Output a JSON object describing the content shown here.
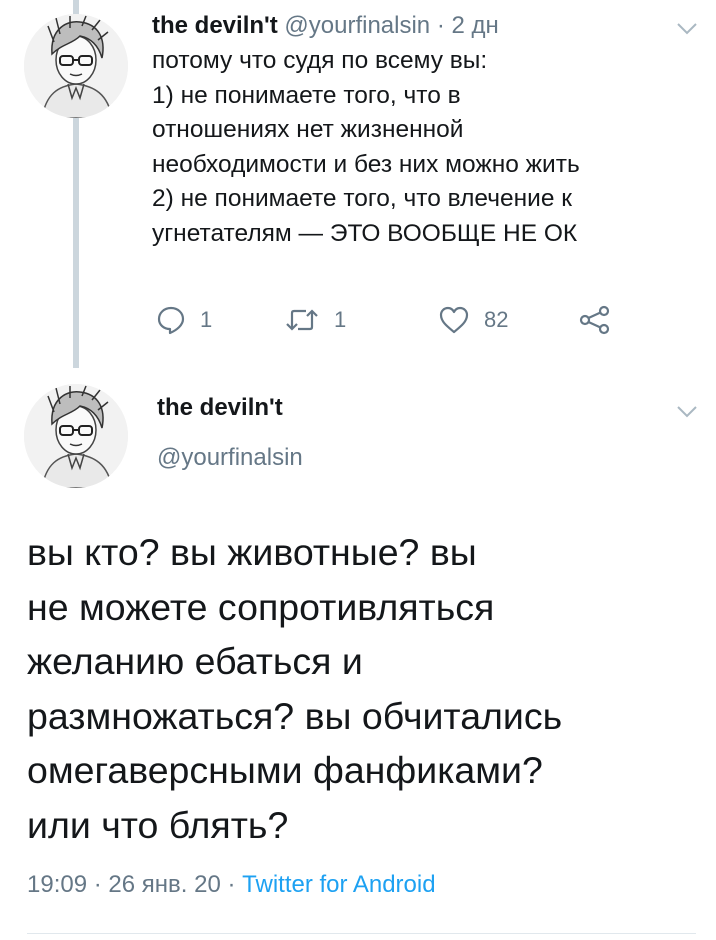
{
  "tweet1": {
    "author_name": "the deviln't",
    "handle": "@yourfinalsin",
    "separator": "·",
    "time": "2 дн",
    "lines": [
      "потому что судя по всему вы:",
      "1) не понимаете того, что в",
      "отношениях нет жизненной",
      "необходимости и без них можно жить",
      "2) не понимаете того, что влечение к",
      "угнетателям — ЭТО ВООБЩЕ НЕ ОК"
    ],
    "actions": {
      "reply_count": "1",
      "retweet_count": "1",
      "like_count": "82"
    }
  },
  "tweet2": {
    "author_name": "the deviln't",
    "handle": "@yourfinalsin",
    "lines": [
      "вы кто? вы животные? вы",
      "не можете сопротивляться",
      "желанию ебаться и",
      "размножаться? вы обчитались",
      "омегаверсными фанфиками?",
      "или что блять?"
    ],
    "meta": {
      "time": "19:09",
      "separator": "·",
      "date": "26 янв. 20",
      "source": "Twitter for Android"
    }
  },
  "colors": {
    "text_primary": "#14171a",
    "text_secondary": "#657786",
    "link": "#1da1f2",
    "thread_line": "#ccd6dd"
  },
  "icons": {
    "avatar": "anime-avatar-sketch",
    "caret": "chevron-down-icon",
    "reply": "reply-icon",
    "retweet": "retweet-icon",
    "like": "heart-icon",
    "share": "share-icon"
  }
}
